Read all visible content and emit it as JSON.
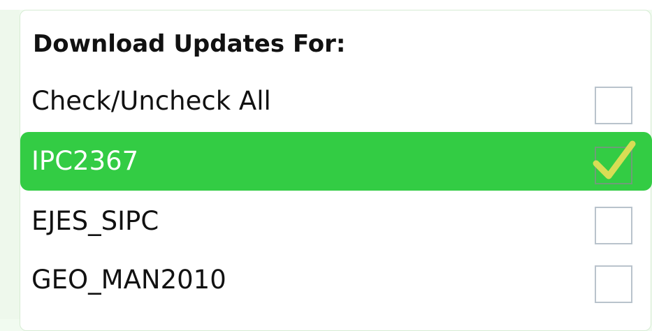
{
  "panel": {
    "title": "Download Updates For:"
  },
  "items": [
    {
      "label": "Check/Uncheck All",
      "checked": false,
      "selected": false
    },
    {
      "label": "IPC2367",
      "checked": true,
      "selected": true
    },
    {
      "label": "EJES_SIPC",
      "checked": false,
      "selected": false
    },
    {
      "label": "GEO_MAN2010",
      "checked": false,
      "selected": false
    }
  ],
  "colors": {
    "selected_row": "#33cc44",
    "check_mark": "#d8dd55",
    "checkbox_border": "#b9c3cc"
  },
  "icons": {
    "check": "checkmark-icon"
  }
}
